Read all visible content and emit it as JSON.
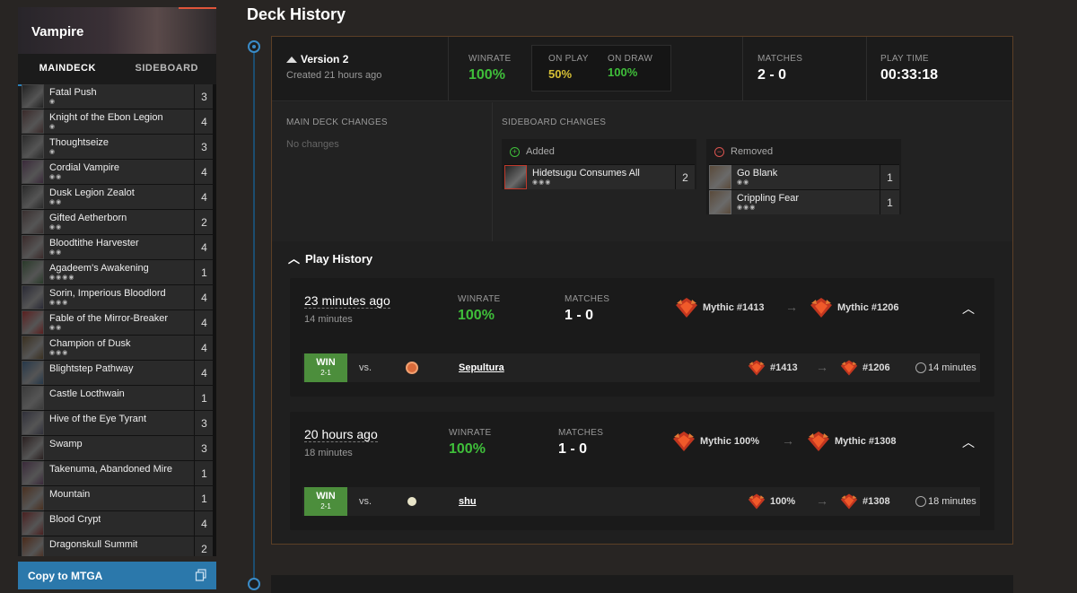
{
  "page_title": "Deck History",
  "sidebar": {
    "deck_name": "Vampire",
    "tabs": [
      "MAINDECK",
      "SIDEBOARD"
    ],
    "cards": [
      {
        "name": "Fatal Push",
        "mana": "◉",
        "count": "3",
        "color": "#222222",
        "bar": "#4a90c8"
      },
      {
        "name": "Knight of the Ebon Legion",
        "mana": "◉",
        "count": "4",
        "color": "#3a2a2a",
        "bar": "#b9a233"
      },
      {
        "name": "Thoughtseize",
        "mana": "◉",
        "count": "3",
        "color": "#2b2b2b",
        "bar": "#b9a233"
      },
      {
        "name": "Cordial Vampire",
        "mana": "◉◉",
        "count": "4",
        "color": "#3a2a3a",
        "bar": "#b9a233"
      },
      {
        "name": "Dusk Legion Zealot",
        "mana": "◉◉",
        "count": "4",
        "color": "#2a2a2a",
        "bar": "#4a90c8"
      },
      {
        "name": "Gifted Aetherborn",
        "mana": "◉◉",
        "count": "2",
        "color": "#3a3030",
        "bar": "#4a90c8"
      },
      {
        "name": "Bloodtithe Harvester",
        "mana": "◉◉",
        "count": "4",
        "color": "#3a2a2a",
        "bar": "#4a90c8"
      },
      {
        "name": "Agadeem's Awakening",
        "mana": "◉◉◉◉",
        "count": "1",
        "color": "#2a3a2a",
        "bar": "#c05a2a"
      },
      {
        "name": "Sorin, Imperious Bloodlord",
        "mana": "◉◉◉",
        "count": "4",
        "color": "#2a2a35",
        "bar": "#c05a2a"
      },
      {
        "name": "Fable of the Mirror-Breaker",
        "mana": "◉◉",
        "count": "4",
        "color": "#5a1f1f",
        "bar": "#c05a2a"
      },
      {
        "name": "Champion of Dusk",
        "mana": "◉◉◉",
        "count": "4",
        "color": "#3a3020",
        "bar": "#c05a2a"
      },
      {
        "name": "Blightstep Pathway",
        "mana": "",
        "count": "4",
        "color": "#26384a",
        "bar": "#b9a233"
      },
      {
        "name": "Castle Locthwain",
        "mana": "",
        "count": "1",
        "color": "#3a3a3a",
        "bar": "#b9a233"
      },
      {
        "name": "Hive of the Eye Tyrant",
        "mana": "",
        "count": "3",
        "color": "#30303a",
        "bar": "#b9a233"
      },
      {
        "name": "Swamp",
        "mana": "",
        "count": "3",
        "color": "#2a2020",
        "bar": "#cfcfcf"
      },
      {
        "name": "Takenuma, Abandoned Mire",
        "mana": "",
        "count": "1",
        "color": "#3a2a3a",
        "bar": "#b9a233"
      },
      {
        "name": "Mountain",
        "mana": "",
        "count": "1",
        "color": "#4a3020",
        "bar": "#cfcfcf"
      },
      {
        "name": "Blood Crypt",
        "mana": "",
        "count": "4",
        "color": "#4a2020",
        "bar": "#b9a233"
      },
      {
        "name": "Dragonskull Summit",
        "mana": "",
        "count": "2",
        "color": "#4a2a1a",
        "bar": "#b9a233"
      }
    ],
    "copy_button": "Copy to MTGA"
  },
  "version": {
    "name": "Version 2",
    "created": "Created 21 hours ago",
    "winrate_label": "WINRATE",
    "winrate": "100%",
    "on_play_label": "ON PLAY",
    "on_play": "50%",
    "on_draw_label": "ON DRAW",
    "on_draw": "100%",
    "matches_label": "MATCHES",
    "matches": "2 - 0",
    "playtime_label": "PLAY TIME",
    "playtime": "00:33:18"
  },
  "changes": {
    "main_label": "MAIN DECK CHANGES",
    "main_value": "No changes",
    "side_label": "SIDEBOARD CHANGES",
    "added_label": "Added",
    "removed_label": "Removed",
    "added": [
      {
        "name": "Hidetsugu Consumes All",
        "mana": "◉◉◉",
        "count": "2"
      }
    ],
    "removed": [
      {
        "name": "Go Blank",
        "mana": "◉◉",
        "count": "1"
      },
      {
        "name": "Crippling Fear",
        "mana": "◉◉◉",
        "count": "1"
      }
    ]
  },
  "play_history": {
    "title": "Play History",
    "sessions": [
      {
        "when": "23 minutes ago",
        "duration": "14 minutes",
        "winrate_label": "WINRATE",
        "winrate": "100%",
        "matches_label": "MATCHES",
        "matches": "1 - 0",
        "rank_from": "Mythic #1413",
        "rank_to": "Mythic #1206",
        "match": {
          "result": "WIN",
          "score": "2-1",
          "vs": "vs.",
          "opponent": "Sepultura",
          "rank_from": "#1413",
          "rank_to": "#1206",
          "duration": "14 minutes"
        }
      },
      {
        "when": "20 hours ago",
        "duration": "18 minutes",
        "winrate_label": "WINRATE",
        "winrate": "100%",
        "matches_label": "MATCHES",
        "matches": "1 - 0",
        "rank_from": "Mythic 100%",
        "rank_to": "Mythic #1308",
        "match": {
          "result": "WIN",
          "score": "2-1",
          "vs": "vs.",
          "opponent": "shu",
          "rank_from": "100%",
          "rank_to": "#1308",
          "duration": "18 minutes"
        }
      }
    ]
  },
  "colors": {
    "accent_blue": "#2b78ab",
    "win_green": "#4c8e3c",
    "winrate_green": "#3fbf3a",
    "on_play_yellow": "#d7c135",
    "panel_border": "#5c3f26"
  }
}
